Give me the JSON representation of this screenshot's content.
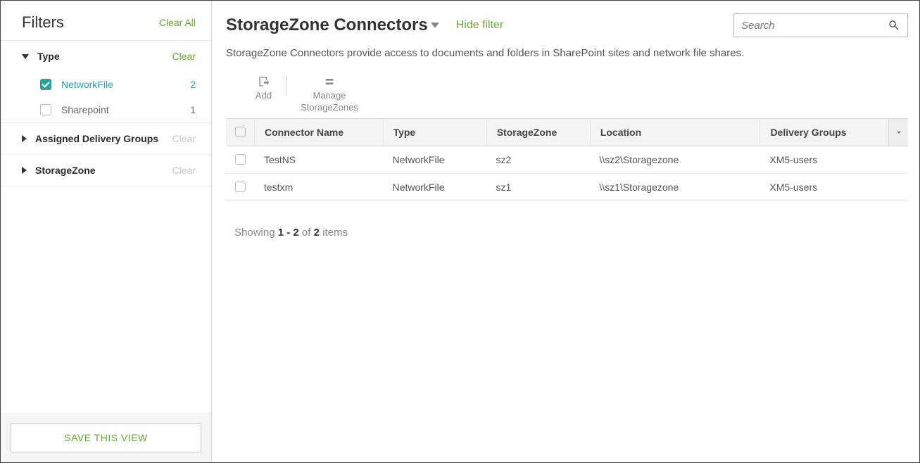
{
  "sidebar": {
    "title": "Filters",
    "clear_all": "Clear All",
    "groups": [
      {
        "label": "Type",
        "clear": "Clear",
        "clear_disabled": false,
        "expanded": true,
        "options": [
          {
            "label": "NetworkFile",
            "count": "2",
            "checked": true
          },
          {
            "label": "Sharepoint",
            "count": "1",
            "checked": false
          }
        ]
      },
      {
        "label": "Assigned Delivery Groups",
        "clear": "Clear",
        "clear_disabled": true,
        "expanded": false,
        "options": []
      },
      {
        "label": "StorageZone",
        "clear": "Clear",
        "clear_disabled": true,
        "expanded": false,
        "options": []
      }
    ],
    "save_view": "SAVE THIS VIEW"
  },
  "header": {
    "title": "StorageZone Connectors",
    "hide_filter": "Hide filter",
    "search_placeholder": "Search"
  },
  "description": "StorageZone Connectors provide access to documents and folders in SharePoint sites and network file shares.",
  "toolbar": {
    "add": "Add",
    "manage_line1": "Manage",
    "manage_line2": "StorageZones"
  },
  "table": {
    "columns": {
      "name": "Connector Name",
      "type": "Type",
      "zone": "StorageZone",
      "location": "Location",
      "groups": "Delivery Groups"
    },
    "rows": [
      {
        "name": "TestNS",
        "type": "NetworkFile",
        "zone": "sz2",
        "location": "\\\\sz2\\Storagezone",
        "groups": "XM5-users"
      },
      {
        "name": "testxm",
        "type": "NetworkFile",
        "zone": "sz1",
        "location": "\\\\sz1\\Storagezone",
        "groups": "XM5-users"
      }
    ]
  },
  "pager": {
    "prefix": "Showing ",
    "range": "1 - 2",
    "mid": " of ",
    "total": "2",
    "suffix": " items"
  }
}
